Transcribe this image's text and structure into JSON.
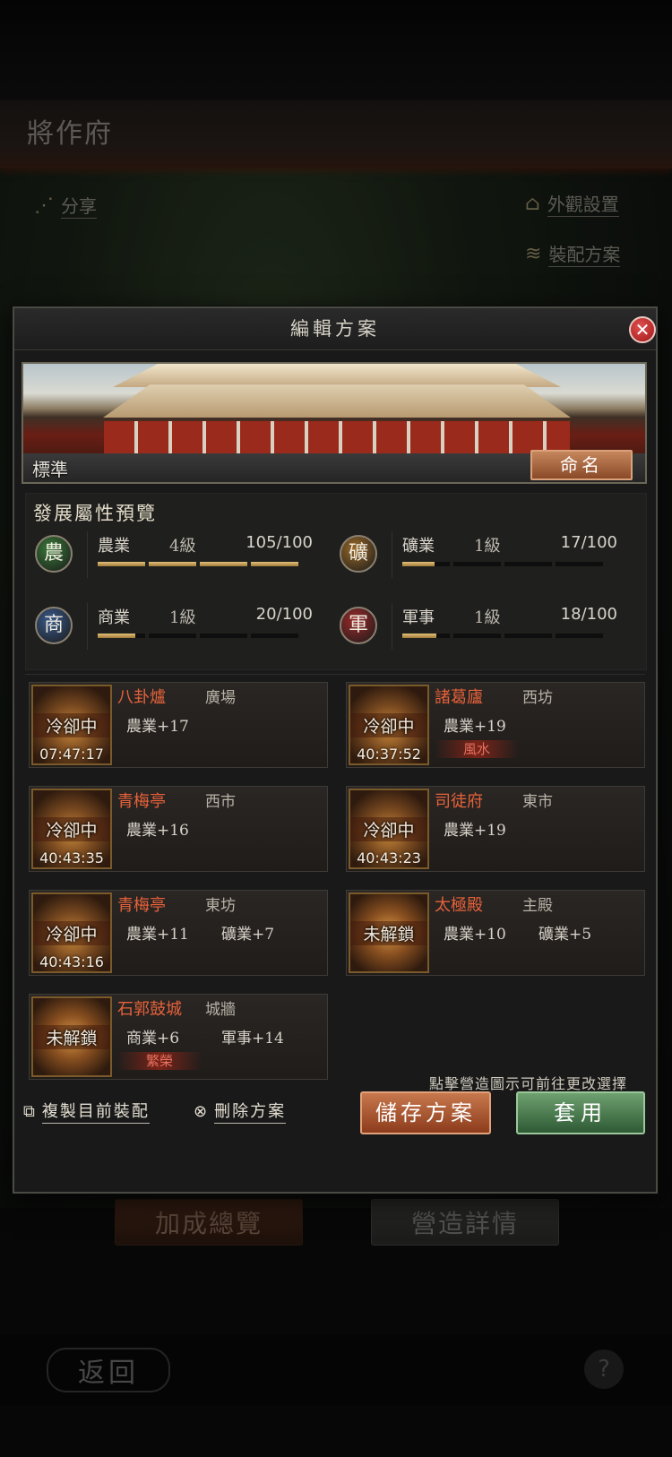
{
  "background": {
    "page_title": "將作府",
    "share_label": "分享",
    "appearance_label": "外觀設置",
    "loadout_label": "裝配方案",
    "bonus_overview_label": "加成總覽",
    "construction_details_label": "營造詳情",
    "back_label": "返回",
    "help_label": "?"
  },
  "dialog": {
    "title": "編輯方案",
    "scheme_name": "標準",
    "rename_label": "命名",
    "attr_heading": "發展屬性預覽",
    "attributes": [
      {
        "badge": "農",
        "name": "農業",
        "level": "4級",
        "progress": "105/100",
        "fill": 1.0,
        "color": "#3a7a3a"
      },
      {
        "badge": "礦",
        "name": "礦業",
        "level": "1級",
        "progress": "17/100",
        "fill": 0.17,
        "color": "#9a6a2a"
      },
      {
        "badge": "商",
        "name": "商業",
        "level": "1級",
        "progress": "20/100",
        "fill": 0.2,
        "color": "#3a5a8a"
      },
      {
        "badge": "軍",
        "name": "軍事",
        "level": "1級",
        "progress": "18/100",
        "fill": 0.18,
        "color": "#9a2a2a"
      }
    ],
    "buildings": [
      {
        "name": "八卦爐",
        "location": "廣場",
        "bonus1": "農業+17",
        "bonus2": "",
        "tag": "",
        "state": "冷卻中",
        "timer": "07:47:17"
      },
      {
        "name": "諸葛廬",
        "location": "西坊",
        "bonus1": "農業+19",
        "bonus2": "",
        "tag": "風水",
        "state": "冷卻中",
        "timer": "40:37:52"
      },
      {
        "name": "青梅亭",
        "location": "西市",
        "bonus1": "農業+16",
        "bonus2": "",
        "tag": "",
        "state": "冷卻中",
        "timer": "40:43:35"
      },
      {
        "name": "司徒府",
        "location": "東市",
        "bonus1": "農業+19",
        "bonus2": "",
        "tag": "",
        "state": "冷卻中",
        "timer": "40:43:23"
      },
      {
        "name": "青梅亭",
        "location": "東坊",
        "bonus1": "農業+11",
        "bonus2": "礦業+7",
        "tag": "",
        "state": "冷卻中",
        "timer": "40:43:16"
      },
      {
        "name": "太極殿",
        "location": "主殿",
        "bonus1": "農業+10",
        "bonus2": "礦業+5",
        "tag": "",
        "state": "未解鎖",
        "timer": ""
      },
      {
        "name": "石郭鼓城",
        "location": "城牆",
        "bonus1": "商業+6",
        "bonus2": "軍事+14",
        "tag": "繁榮",
        "state": "未解鎖",
        "timer": ""
      }
    ],
    "hint": "點擊營造圖示可前往更改選擇",
    "copy_label": "複製目前裝配",
    "delete_label": "刪除方案",
    "save_label": "儲存方案",
    "apply_label": "套用"
  }
}
